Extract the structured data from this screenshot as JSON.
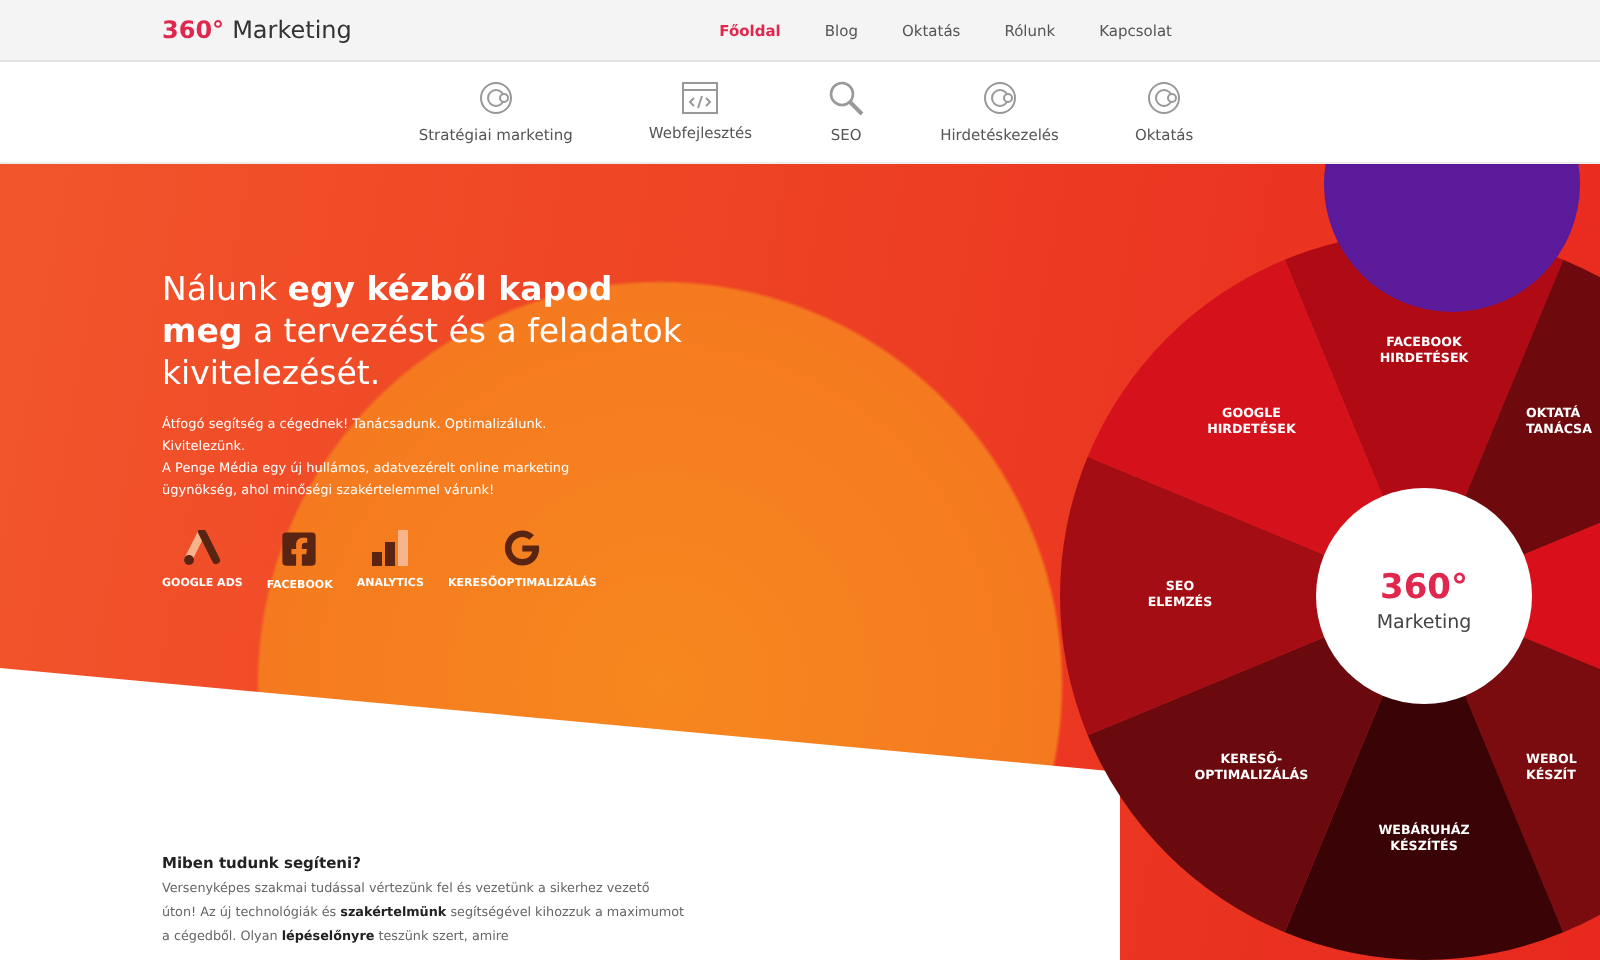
{
  "logo": {
    "accent": "360°",
    "text": "Marketing"
  },
  "nav": [
    {
      "label": "Főoldal",
      "selected": true
    },
    {
      "label": "Blog",
      "selected": false
    },
    {
      "label": "Oktatás",
      "selected": false
    },
    {
      "label": "Rólunk",
      "selected": false
    },
    {
      "label": "Kapcsolat",
      "selected": false
    }
  ],
  "services_nav": [
    {
      "kind": "target",
      "label": "Stratégiai marketing"
    },
    {
      "kind": "code",
      "label": "Webfejlesztés"
    },
    {
      "kind": "search",
      "label": "SEO"
    },
    {
      "kind": "target",
      "label": "Hirdetéskezelés"
    },
    {
      "kind": "target",
      "label": "Oktatás"
    }
  ],
  "hero": {
    "headline": "Nálunk **egy kézből kapod meg** a tervezést és a feladatok kivitelezését.",
    "paragraphs": [
      "Átfogó segítség a cégednek! Tanácsadunk. Optimalizálunk. Kivitelezünk.",
      "A Penge Média egy új hullámos, adatvezérelt online marketing ügynökség, ahol minőségi szakértelemmel várunk!"
    ],
    "platforms": [
      {
        "kind": "ads",
        "label": "GOOGLE ADS"
      },
      {
        "kind": "facebook",
        "label": "FACEBOOK"
      },
      {
        "kind": "analytics",
        "label": "ANALYTICS"
      },
      {
        "kind": "google",
        "label": "KERESŐOPTIMALIZÁLÁS"
      }
    ]
  },
  "wheel": {
    "center_title": "360°",
    "center_subtitle": "Marketing",
    "segments": [
      {
        "lines": [
          "FACEBOOK",
          "HIRDETÉSEK"
        ],
        "color": "#b00a14"
      },
      {
        "lines": [
          "OKTATÁ",
          "TANÁCSA"
        ],
        "color": "#6e0a0e"
      },
      {
        "color": "#d9101c"
      },
      {
        "lines": [
          "WEBOL",
          "KÉSZÍT"
        ],
        "color": "#7a0c10"
      },
      {
        "lines": [
          "WEBÁRUHÁZ",
          "KÉSZÍTÉS"
        ],
        "color": "#3a0306"
      },
      {
        "lines": [
          "KERESŐ-",
          "OPTIMALIZÁLÁS"
        ],
        "color": "#6a0a0e"
      },
      {
        "lines": [
          "SEO",
          "ELEMZÉS"
        ],
        "color": "#a50d14"
      },
      {
        "lines": [
          "GOOGLE",
          "HIRDETÉSEK"
        ],
        "color": "#d5121c"
      }
    ]
  },
  "about": {
    "title": "Miben tudunk segíteni?",
    "text": "Versenyképes szakmai tudással vértezünk fel és vezetünk a sikerhez vezető úton! Az új technológiák és **szakértelmünk** segítségével kihozzuk a maximumot a cégedből. Olyan **lépéselőnyre** teszünk szert, amire"
  }
}
